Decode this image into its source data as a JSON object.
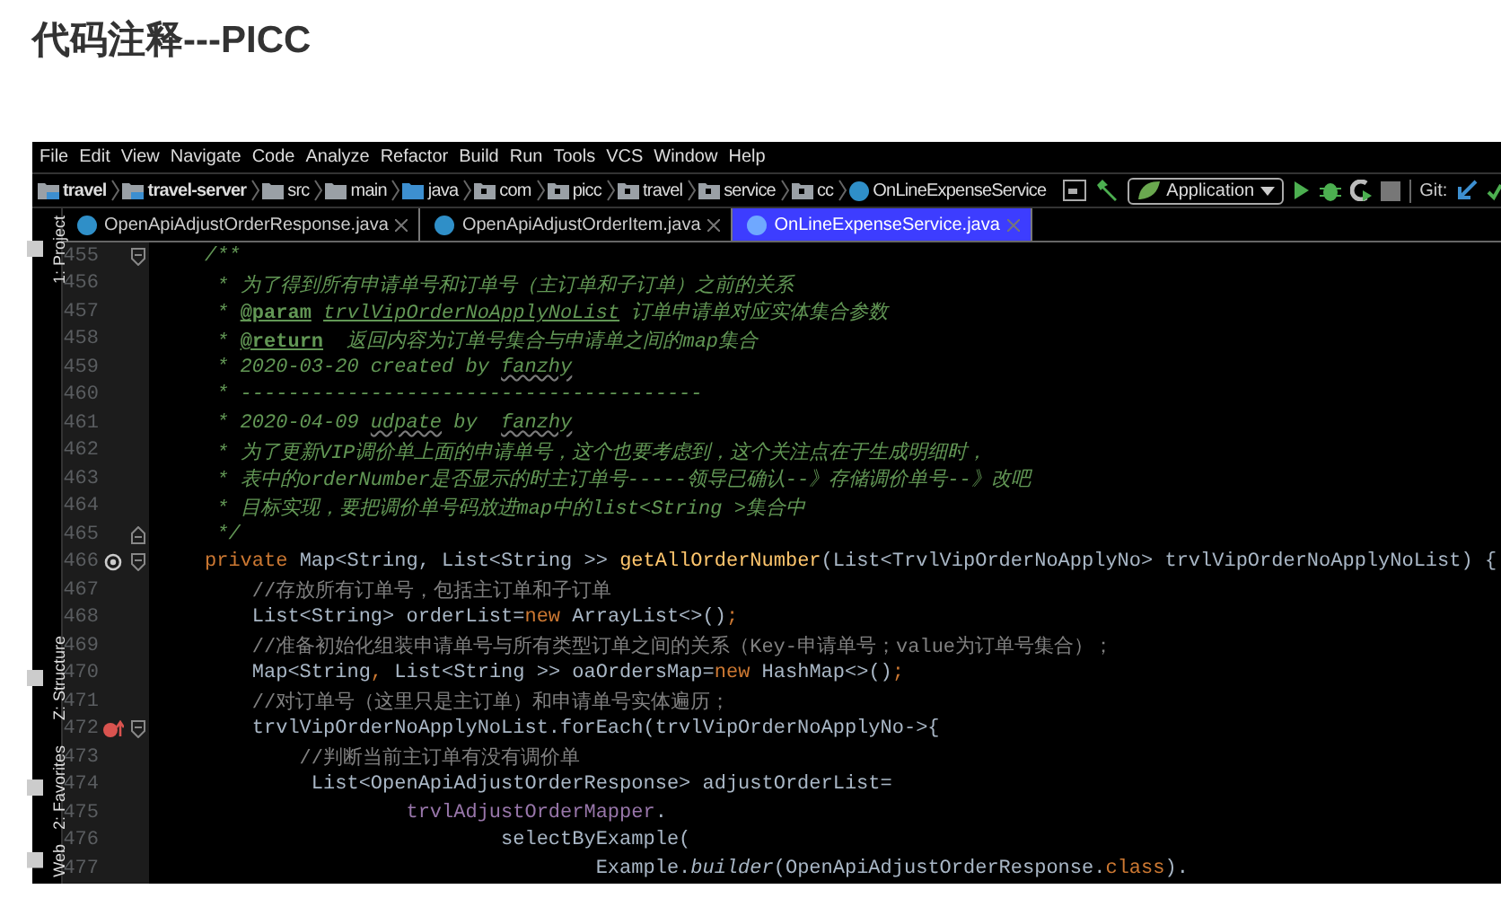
{
  "page_title": "代码注释---PICC",
  "ide": {
    "menu": [
      "File",
      "Edit",
      "View",
      "Navigate",
      "Code",
      "Analyze",
      "Refactor",
      "Build",
      "Run",
      "Tools",
      "VCS",
      "Window",
      "Help"
    ],
    "breadcrumbs": [
      {
        "label": "travel",
        "kind": "module"
      },
      {
        "label": "travel-server",
        "kind": "module"
      },
      {
        "label": "src",
        "kind": "folder"
      },
      {
        "label": "main",
        "kind": "folder"
      },
      {
        "label": "java",
        "kind": "source"
      },
      {
        "label": "com",
        "kind": "package"
      },
      {
        "label": "picc",
        "kind": "package"
      },
      {
        "label": "travel",
        "kind": "package"
      },
      {
        "label": "service",
        "kind": "package"
      },
      {
        "label": "cc",
        "kind": "package"
      },
      {
        "label": "OnLineExpenseService",
        "kind": "class"
      }
    ],
    "run_config": "Application",
    "vcs_label": "Git:",
    "tool_windows": [
      "1: Project",
      "Z: Structure",
      "2: Favorites",
      "Web"
    ],
    "tabs": [
      {
        "label": "OpenApiAdjustOrderResponse.java",
        "selected": false
      },
      {
        "label": "OpenApiAdjustOrderItem.java",
        "selected": false
      },
      {
        "label": "OnLineExpenseService.java",
        "selected": true
      }
    ],
    "lines": [
      {
        "number": "455",
        "fold_start": true,
        "fold_end": false,
        "annotation": false,
        "override": false,
        "tokens": [
          {
            "kind": "doc",
            "text": "/**"
          }
        ]
      },
      {
        "number": "456",
        "fold_start": false,
        "fold_end": false,
        "annotation": false,
        "override": false,
        "tokens": [
          {
            "kind": "doc",
            "text": " * 为了得到所有申请单号和订单号（主订单和子订单）之前的关系"
          }
        ]
      },
      {
        "number": "457",
        "fold_start": false,
        "fold_end": false,
        "annotation": false,
        "override": false,
        "tokens": [
          {
            "kind": "doc",
            "text": " * "
          },
          {
            "kind": "tag",
            "text": "@param"
          },
          {
            "kind": "param",
            "text": "trvlVipOrderNoApplyNoList"
          },
          {
            "kind": "doc",
            "text": " 订单申请单对应实体集合参数"
          }
        ]
      },
      {
        "number": "458",
        "fold_start": false,
        "fold_end": false,
        "annotation": false,
        "override": false,
        "tokens": [
          {
            "kind": "doc",
            "text": " * "
          },
          {
            "kind": "tag",
            "text": "@return"
          },
          {
            "kind": "doc",
            "text": "  返回内容为订单号集合与申请单之间的map集合"
          }
        ]
      },
      {
        "number": "459",
        "fold_start": false,
        "fold_end": false,
        "annotation": false,
        "override": false,
        "tokens": [
          {
            "kind": "doc",
            "text": " * 2020-03-20 created by "
          },
          {
            "kind": "typo",
            "text": "fanzhy"
          }
        ]
      },
      {
        "number": "460",
        "fold_start": false,
        "fold_end": false,
        "annotation": false,
        "override": false,
        "tokens": [
          {
            "kind": "doc",
            "text": " * ---------------------------------------"
          }
        ]
      },
      {
        "number": "461",
        "fold_start": false,
        "fold_end": false,
        "annotation": false,
        "override": false,
        "tokens": [
          {
            "kind": "doc",
            "text": " * 2020-04-09 "
          },
          {
            "kind": "typo",
            "text": "udpate"
          },
          {
            "kind": "doc",
            "text": " by  "
          },
          {
            "kind": "typo",
            "text": "fanzhy"
          }
        ]
      },
      {
        "number": "462",
        "fold_start": false,
        "fold_end": false,
        "annotation": false,
        "override": false,
        "tokens": [
          {
            "kind": "doc",
            "text": " * 为了更新VIP调价单上面的申请单号，这个也要考虑到，这个关注点在于生成明细时，"
          }
        ]
      },
      {
        "number": "463",
        "fold_start": false,
        "fold_end": false,
        "annotation": false,
        "override": false,
        "tokens": [
          {
            "kind": "doc",
            "text": " * 表中的orderNumber是否显示的时主订单号-----领导已确认--》存储调价单号--》改吧"
          }
        ]
      },
      {
        "number": "464",
        "fold_start": false,
        "fold_end": false,
        "annotation": false,
        "override": false,
        "tokens": [
          {
            "kind": "doc",
            "text": " * 目标实现，要把调价单号码放进map中的list<String >集合中"
          }
        ]
      },
      {
        "number": "465",
        "fold_start": false,
        "fold_end": true,
        "annotation": false,
        "override": false,
        "tokens": [
          {
            "kind": "doc",
            "text": " */"
          }
        ]
      },
      {
        "number": "466",
        "fold_start": true,
        "fold_end": false,
        "annotation": true,
        "override": false,
        "tokens": [
          {
            "kind": "keyword",
            "text": "private"
          },
          {
            "kind": "plain",
            "text": " Map<String, List<String >> "
          },
          {
            "kind": "method",
            "text": "getAllOrderNumber"
          },
          {
            "kind": "plain",
            "text": "(List<TrvlVipOrderNoApplyNo> trvlVipOrderNoApplyNoList) {"
          }
        ]
      },
      {
        "number": "467",
        "fold_start": false,
        "fold_end": false,
        "annotation": false,
        "override": false,
        "tokens": [
          {
            "kind": "comment",
            "text": "    //存放所有订单号，包括主订单和子订单"
          }
        ]
      },
      {
        "number": "468",
        "fold_start": false,
        "fold_end": false,
        "annotation": false,
        "override": false,
        "tokens": [
          {
            "kind": "plain",
            "text": "    List<String> orderList="
          },
          {
            "kind": "keyword",
            "text": "new"
          },
          {
            "kind": "plain",
            "text": " ArrayList<>()"
          },
          {
            "kind": "keyword",
            "text": ";"
          }
        ]
      },
      {
        "number": "469",
        "fold_start": false,
        "fold_end": false,
        "annotation": false,
        "override": false,
        "tokens": [
          {
            "kind": "comment",
            "text": "    //准备初始化组装申请单号与所有类型订单之间的关系（Key-申请单号；value为订单号集合）；"
          }
        ]
      },
      {
        "number": "470",
        "fold_start": false,
        "fold_end": false,
        "annotation": false,
        "override": false,
        "tokens": [
          {
            "kind": "plain",
            "text": "    Map<String"
          },
          {
            "kind": "keyword",
            "text": ","
          },
          {
            "kind": "plain",
            "text": " List<String >> oaOrdersMap="
          },
          {
            "kind": "keyword",
            "text": "new"
          },
          {
            "kind": "plain",
            "text": " HashMap<>()"
          },
          {
            "kind": "keyword",
            "text": ";"
          }
        ]
      },
      {
        "number": "471",
        "fold_start": false,
        "fold_end": false,
        "annotation": false,
        "override": false,
        "tokens": [
          {
            "kind": "comment",
            "text": "    //对订单号（这里只是主订单）和申请单号实体遍历；"
          }
        ]
      },
      {
        "number": "472",
        "fold_start": true,
        "fold_end": false,
        "annotation": false,
        "override": true,
        "tokens": [
          {
            "kind": "plain",
            "text": "    trvlVipOrderNoApplyNoList.forEach(trvlVipOrderNoApplyNo->{"
          }
        ]
      },
      {
        "number": "473",
        "fold_start": false,
        "fold_end": false,
        "annotation": false,
        "override": false,
        "tokens": [
          {
            "kind": "comment",
            "text": "        //判断当前主订单有没有调价单"
          }
        ]
      },
      {
        "number": "474",
        "fold_start": false,
        "fold_end": false,
        "annotation": false,
        "override": false,
        "tokens": [
          {
            "kind": "plain",
            "text": "         List<OpenApiAdjustOrderResponse> adjustOrderList="
          }
        ]
      },
      {
        "number": "475",
        "fold_start": false,
        "fold_end": false,
        "annotation": false,
        "override": false,
        "tokens": [
          {
            "kind": "field",
            "text": "                 trvlAdjustOrderMapper"
          },
          {
            "kind": "plain",
            "text": "."
          }
        ]
      },
      {
        "number": "476",
        "fold_start": false,
        "fold_end": false,
        "annotation": false,
        "override": false,
        "tokens": [
          {
            "kind": "plain",
            "text": "                         selectByExample("
          }
        ]
      },
      {
        "number": "477",
        "fold_start": false,
        "fold_end": false,
        "annotation": false,
        "override": false,
        "tokens": [
          {
            "kind": "plain",
            "text": "                                 Example."
          },
          {
            "kind": "static",
            "text": "builder"
          },
          {
            "kind": "plain",
            "text": "(OpenApiAdjustOrderResponse."
          },
          {
            "kind": "keyword",
            "text": "class"
          },
          {
            "kind": "plain",
            "text": ")."
          }
        ]
      }
    ]
  }
}
